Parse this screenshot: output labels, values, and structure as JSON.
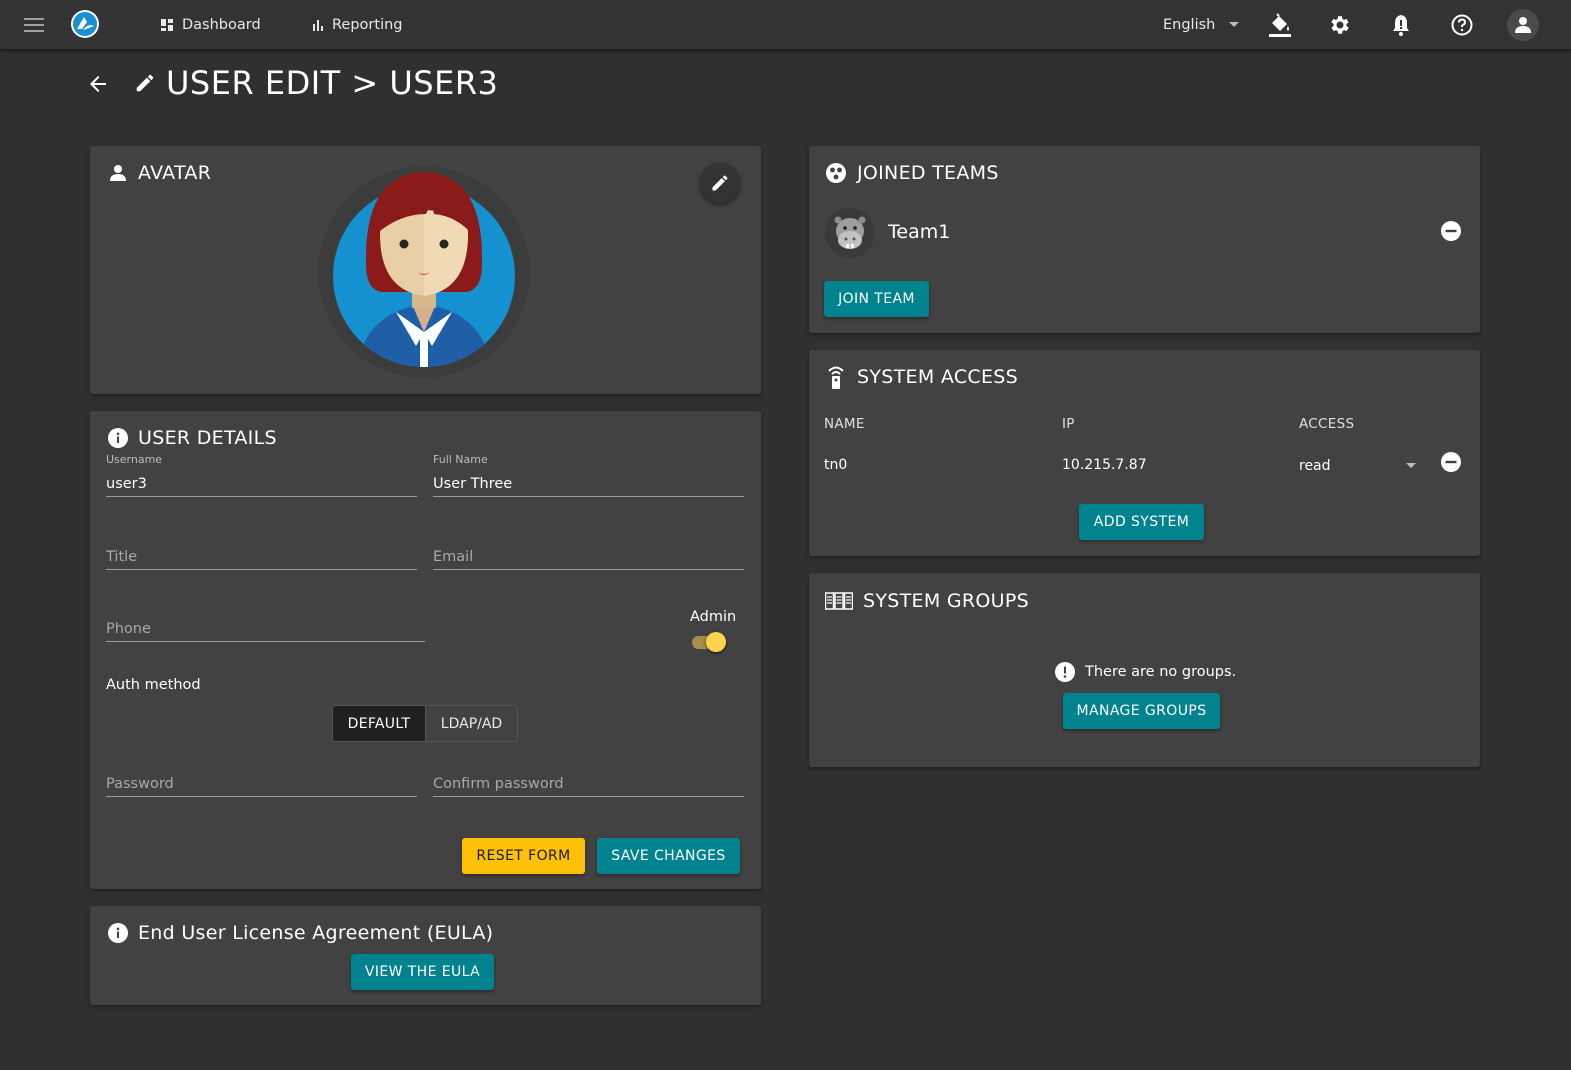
{
  "topbar": {
    "nav": [
      {
        "label": "Dashboard",
        "icon": "dashboard-icon"
      },
      {
        "label": "Reporting",
        "icon": "bar-chart-icon"
      }
    ],
    "language": "English",
    "icons": [
      "menu-icon",
      "logo-icon",
      "paint-bucket-icon",
      "gear-icon",
      "bell-icon",
      "help-icon",
      "account-icon"
    ]
  },
  "page": {
    "title": "USER EDIT > USER3"
  },
  "avatar_card": {
    "title": "AVATAR"
  },
  "user_details": {
    "title": "USER DETAILS",
    "username_label": "Username",
    "username_value": "user3",
    "fullname_label": "Full Name",
    "fullname_value": "User Three",
    "title_placeholder": "Title",
    "email_placeholder": "Email",
    "phone_placeholder": "Phone",
    "admin_label": "Admin",
    "admin_enabled": true,
    "auth_method_label": "Auth method",
    "auth_options": [
      "DEFAULT",
      "LDAP/AD"
    ],
    "auth_selected": "DEFAULT",
    "password_placeholder": "Password",
    "confirm_password_placeholder": "Confirm password",
    "reset_label": "RESET FORM",
    "save_label": "SAVE CHANGES"
  },
  "eula": {
    "title": "End User License Agreement (EULA)",
    "button_label": "VIEW THE EULA"
  },
  "joined_teams": {
    "title": "JOINED TEAMS",
    "teams": [
      {
        "name": "Team1"
      }
    ],
    "join_label": "JOIN TEAM"
  },
  "system_access": {
    "title": "SYSTEM ACCESS",
    "columns": [
      "NAME",
      "IP",
      "ACCESS"
    ],
    "rows": [
      {
        "name": "tn0",
        "ip": "10.215.7.87",
        "access": "read"
      }
    ],
    "add_label": "ADD SYSTEM"
  },
  "system_groups": {
    "title": "SYSTEM GROUPS",
    "empty_text": "There are no groups.",
    "manage_label": "MANAGE GROUPS"
  },
  "colors": {
    "background": "#303030",
    "card": "#424242",
    "teal": "#00838f",
    "yellow": "#ffc107"
  }
}
